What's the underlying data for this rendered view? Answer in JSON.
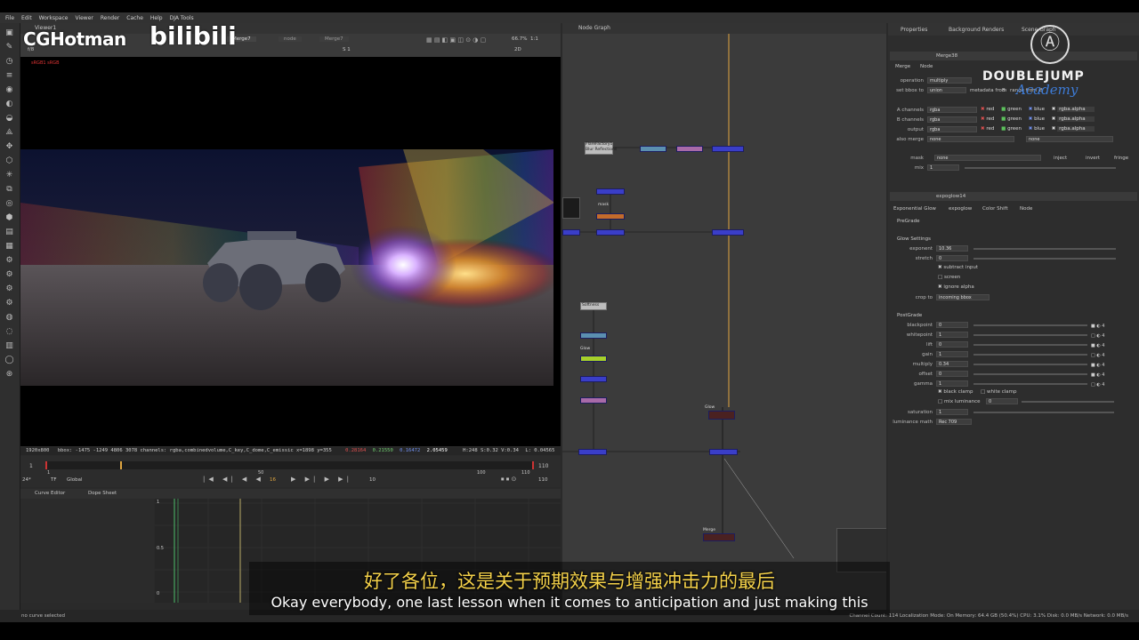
{
  "menu": [
    "File",
    "Edit",
    "Workspace",
    "Viewer",
    "Render",
    "Cache",
    "Help",
    "DJA Tools"
  ],
  "viewer": {
    "tab": "Viewer1",
    "input_a": "Merge7",
    "input_b": "Merge7",
    "b_label": "node",
    "zoom": "66.7%",
    "proxy": "1:1",
    "mode": "2D",
    "frame_label": "f/8",
    "layer": "S 1",
    "red_text": "sRGB1 sRGB"
  },
  "infobar": {
    "format": "1920x800",
    "bbox": "bbox: -1475 -1249 4806 3078 channels: rgba,combinedvolume,C_key,C_dome,C_emissic  x=1898 y=355",
    "r": "0.28164",
    "g": "0.21550",
    "b": "0.16472",
    "a": "2.05459",
    "hsv": "H:248 S:0.32 V:0.34",
    "l": "L: 0.04565"
  },
  "timeline": {
    "start": "1",
    "end": "110",
    "ticks": [
      "1",
      "50",
      "100",
      "110"
    ],
    "fps": "24*",
    "tf": "TF",
    "global": "Global",
    "current_frame": "16",
    "step": "10",
    "out_frame": "110"
  },
  "curve": {
    "tabs": [
      "Curve Editor",
      "Dope Sheet"
    ],
    "yticks": [
      "1",
      "0.5",
      "0"
    ]
  },
  "nodegraph": {
    "tab": "Node Graph",
    "labels": {
      "flare": "FlareFactory1",
      "flare2": "Blur Reflections",
      "soft": "Softness",
      "mask": "mask",
      "glow": "Glow",
      "glow2": "Glow",
      "merge": "Merge",
      "merge2": "Merge"
    }
  },
  "props": {
    "tabs": [
      "Properties",
      "Background Renders",
      "Scene Graph"
    ],
    "merge_node": "Merge38",
    "merge_tabs": [
      "Merge",
      "Node"
    ],
    "operation": "multiply",
    "bbox_to": "union",
    "metadata_from": "metadata from",
    "metadata_val": "B",
    "range_from": "range from",
    "range_val": "B",
    "a_channels": "rgba",
    "b_channels": "rgba",
    "output": "rgba",
    "also_merge": "none",
    "also_merge2": "none",
    "channel_flags": [
      "red",
      "green",
      "blue",
      "rgba.alpha"
    ],
    "mask": "none",
    "inject": "inject",
    "invert": "invert",
    "fringe": "fringe",
    "mix": "1",
    "glow_node": "expoglow14",
    "glow_tabs": [
      "Exponential Glow",
      "expoglow",
      "Color Shift",
      "Node"
    ],
    "pregrade": "PreGrade",
    "glow_settings": "Glow Settings",
    "exponent": "10.36",
    "stretch": "0",
    "subtract_input": "subtract input",
    "screen": "screen",
    "ignore_alpha": "ignore alpha",
    "crop_to": "incoming bbox",
    "postgrade": "PostGrade",
    "blackpoint": "0",
    "whitepoint": "1",
    "lift": "0",
    "gain": "1",
    "multiply": "0.34",
    "offset": "0",
    "gamma": "1",
    "black_clamp": "black clamp",
    "white_clamp": "white clamp",
    "mix_luminance": "mix luminance",
    "mix_luminance_val": "0",
    "saturation": "1",
    "luminance_math": "Rec 709",
    "labels": {
      "operation": "operation",
      "bbox": "set bbox to",
      "a": "A channels",
      "b": "B channels",
      "output": "output",
      "also": "also merge",
      "mask": "mask",
      "mix": "mix",
      "exponent": "exponent",
      "stretch": "stretch",
      "crop": "crop to",
      "blackpoint": "blackpoint",
      "whitepoint": "whitepoint",
      "lift": "lift",
      "gain": "gain",
      "multiply": "multiply",
      "offset": "offset",
      "gamma": "gamma",
      "saturation": "saturation",
      "lum": "luminance math"
    }
  },
  "statusbar": {
    "left": "no curve selected",
    "right": "Channel Count: 114  Localization Mode: On  Memory: 64.4 GB (50.4%)  CPU: 3.1%  Disk: 0.0 MB/s  Network: 0.0 MB/s"
  },
  "subtitles": {
    "zh": "好了各位，这是关于预期效果与增强冲击力的最后",
    "en": "Okay everybody, one last lesson when it comes to anticipation and just making this"
  },
  "watermarks": {
    "channel": "CGHotman",
    "site": "bilibili",
    "brand": "DOUBLEJUMP",
    "brand2": "Academy"
  },
  "colors": {
    "accent_blue": "#3a3ec8",
    "subtitle_yellow": "#f5d24a",
    "node_line": "#e0a640"
  }
}
